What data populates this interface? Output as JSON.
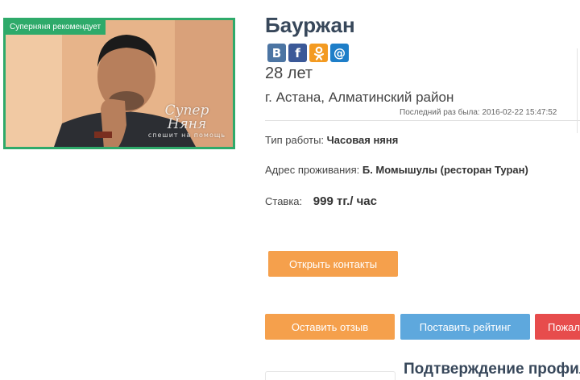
{
  "profile": {
    "badge": "Суперняня рекомендует",
    "watermark_title": "Супер Няня",
    "watermark_sub": "спешит на помощь",
    "name": "Бауржан",
    "age": "28 лет",
    "location": "г. Астана, Алматинский район",
    "last_seen_label": "Последний раз была:",
    "last_seen_value": "2016-02-22 15:47:52"
  },
  "social": {
    "icons": [
      "vk-icon",
      "facebook-icon",
      "odnoklassniki-icon",
      "mail-icon"
    ],
    "glyphs": [
      "B",
      "f",
      "ok",
      "@"
    ]
  },
  "details": {
    "work_type_label": "Тип работы:",
    "work_type_value": "Часовая няня",
    "address_label": "Адрес проживания:",
    "address_value": "Б. Момышулы (ресторан Туран)",
    "rate_label": "Ставка:",
    "rate_value": "999 тг./ час"
  },
  "buttons": {
    "open_contacts": "Открыть контакты",
    "leave_review": "Оставить отзыв",
    "rate": "Поставить рейтинг",
    "complain": "Пожаловаться"
  },
  "confirmation": {
    "title": "Подтверждение профиля"
  },
  "colors": {
    "accent_green": "#2eaa6a",
    "orange_button": "#f5a04c",
    "blue_button": "#5ea8dd",
    "red_button": "#e74c4c",
    "heading": "#37475a"
  }
}
